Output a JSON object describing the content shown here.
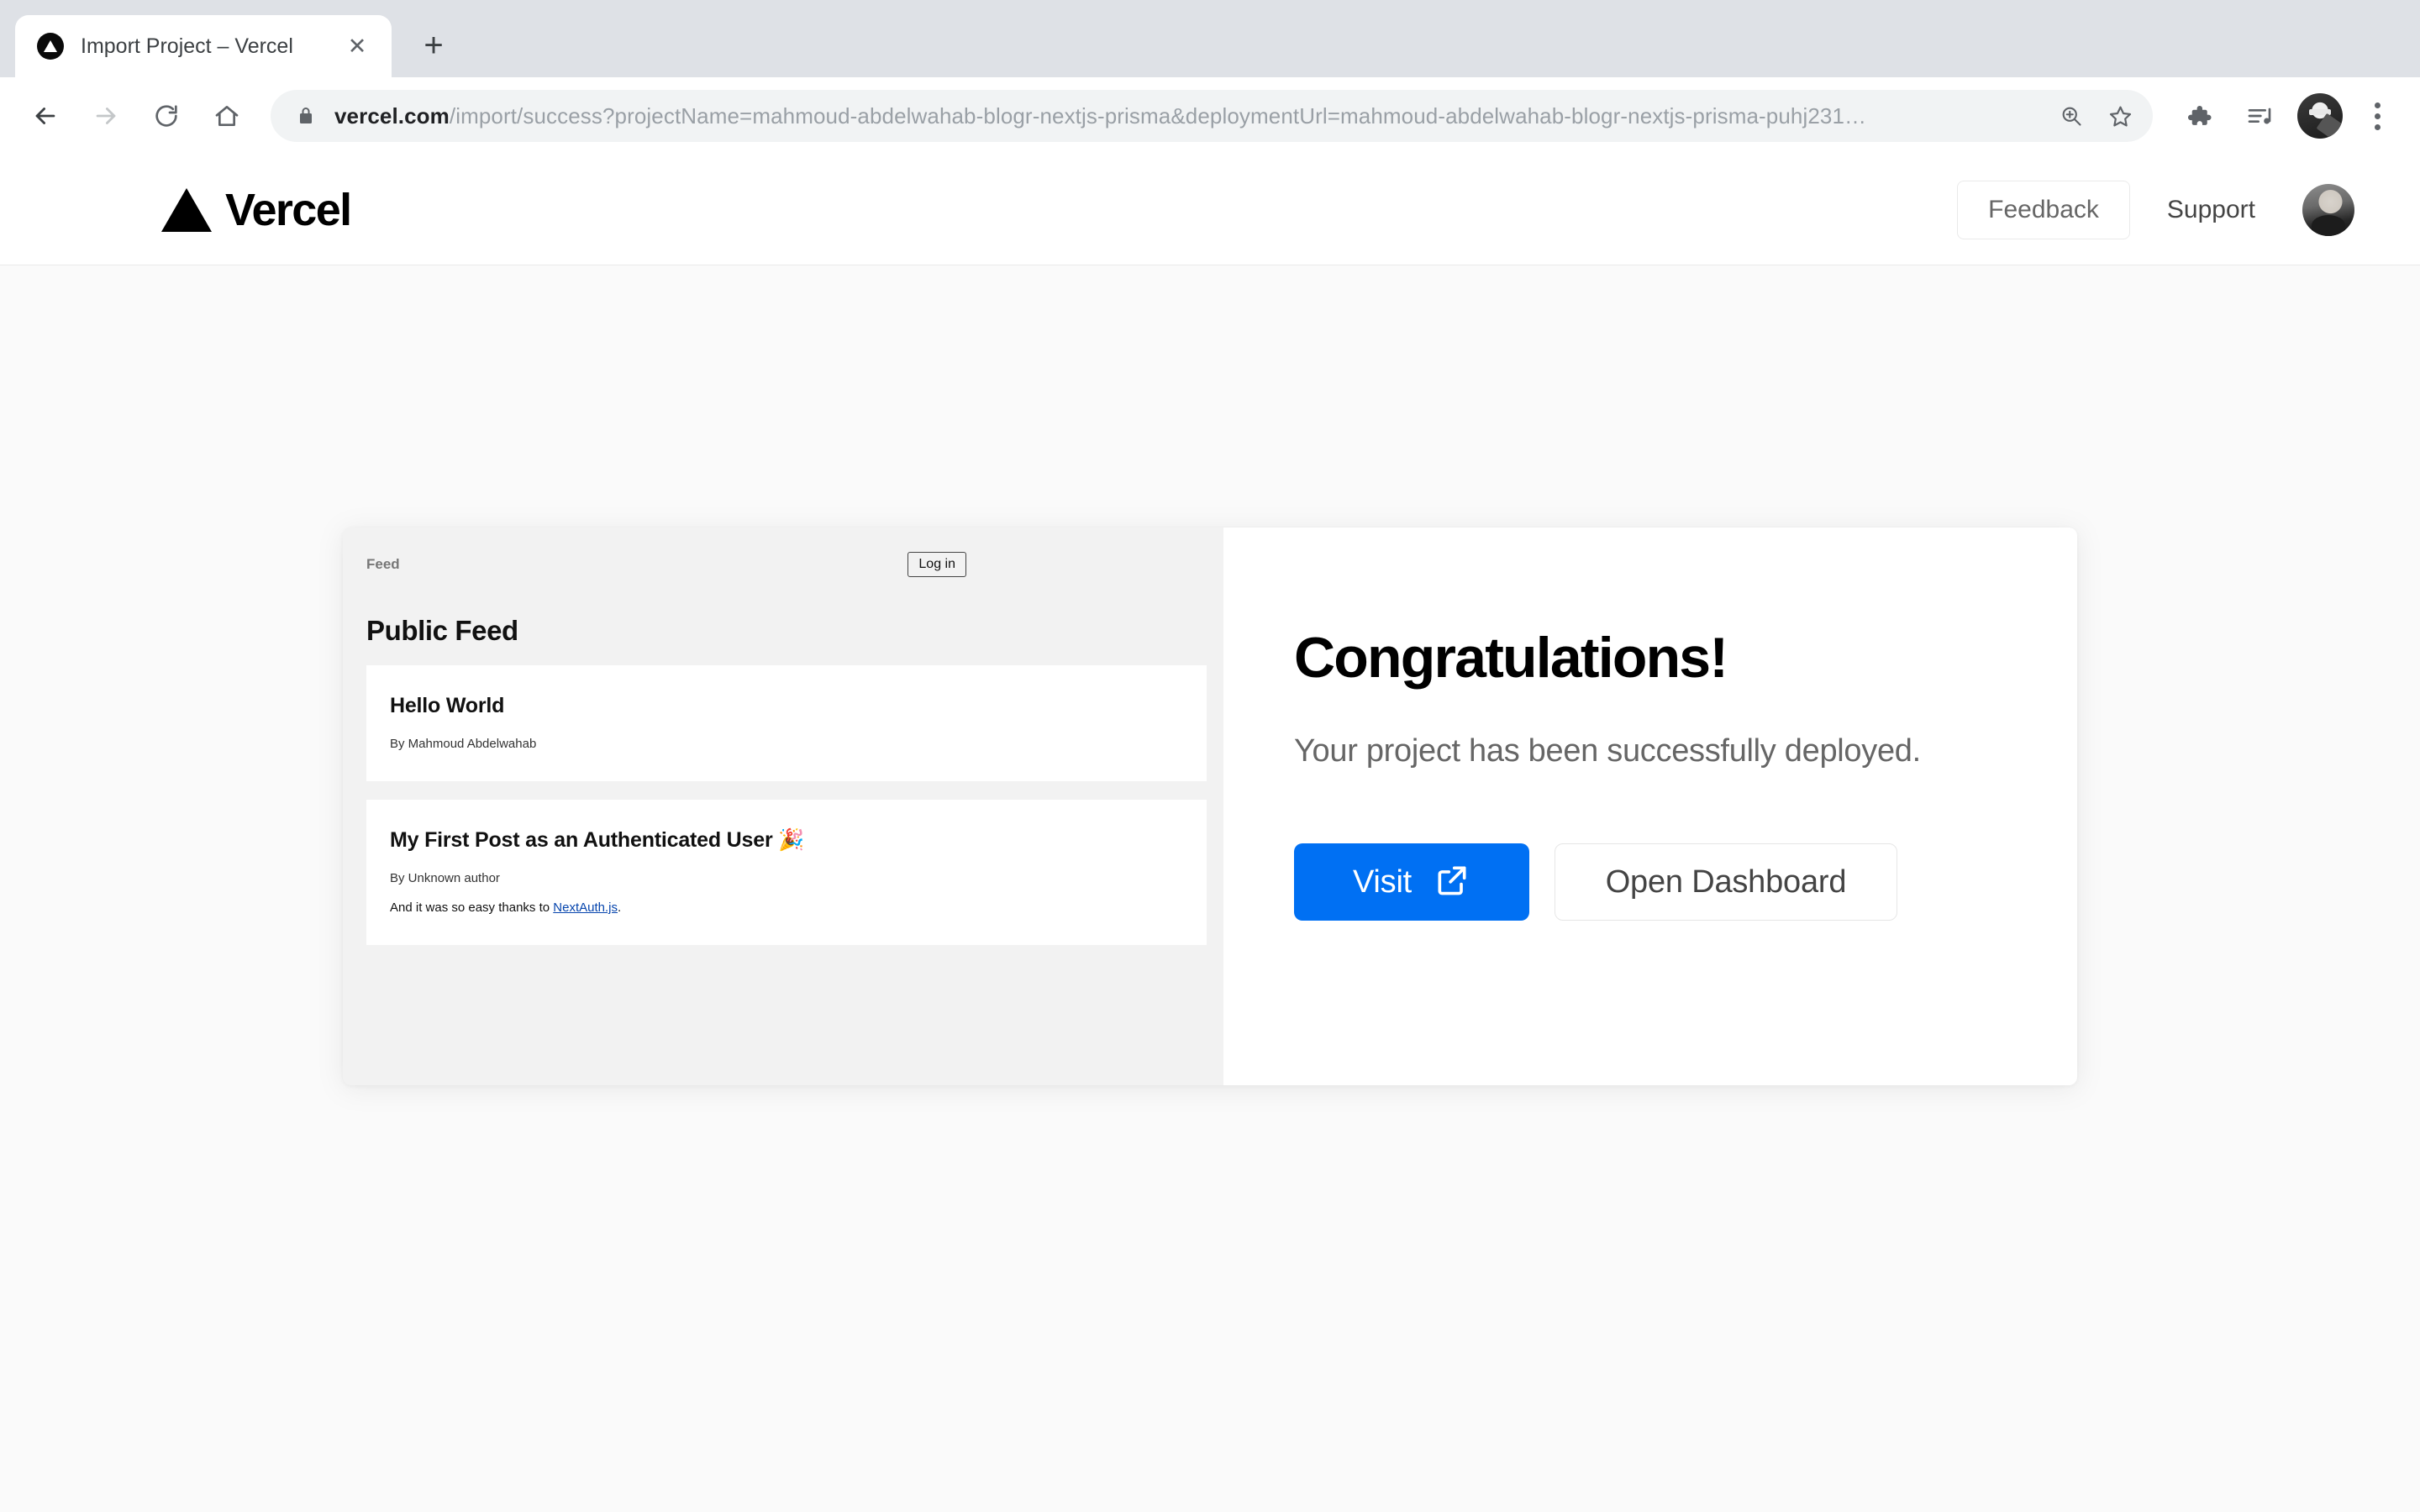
{
  "browser": {
    "tab": {
      "title": "Import Project – Vercel",
      "favicon": "vercel-triangle-icon",
      "close_label": "✕"
    },
    "new_tab_label": "+",
    "nav": {
      "back": "back-arrow-icon",
      "forward": "forward-arrow-icon",
      "reload": "reload-icon",
      "home": "home-icon"
    },
    "omnibox": {
      "lock": "lock-icon",
      "host": "vercel.com",
      "path": "/import/success?projectName=mahmoud-abdelwahab-blogr-nextjs-prisma&deploymentUrl=mahmoud-abdelwahab-blogr-nextjs-prisma-puhj231…",
      "zoom_icon": "zoom-in-icon",
      "bookmark_icon": "star-icon"
    },
    "toolbar_icons": {
      "extensions": "puzzle-icon",
      "media": "media-playlist-icon",
      "profile": "profile-avatar-icon",
      "menu": "three-dot-menu-icon"
    }
  },
  "site_header": {
    "logo_text": "Vercel",
    "logo_mark": "vercel-triangle-icon",
    "feedback_label": "Feedback",
    "support_label": "Support",
    "avatar": "user-avatar"
  },
  "preview": {
    "nav_link": "Feed",
    "login_label": "Log in",
    "heading": "Public Feed",
    "posts": [
      {
        "title": "Hello World",
        "author": "By Mahmoud Abdelwahab",
        "body_prefix": "",
        "link_text": "",
        "body_suffix": ""
      },
      {
        "title": "My First Post as an Authenticated User 🎉",
        "author": "By Unknown author",
        "body_prefix": "And it was so easy thanks to ",
        "link_text": "NextAuth.js",
        "body_suffix": "."
      }
    ]
  },
  "congrats": {
    "title": "Congratulations!",
    "subtitle": "Your project has been successfully deployed.",
    "visit_label": "Visit",
    "visit_icon": "external-link-icon",
    "dashboard_label": "Open Dashboard",
    "accent_color": "#0070f3"
  }
}
